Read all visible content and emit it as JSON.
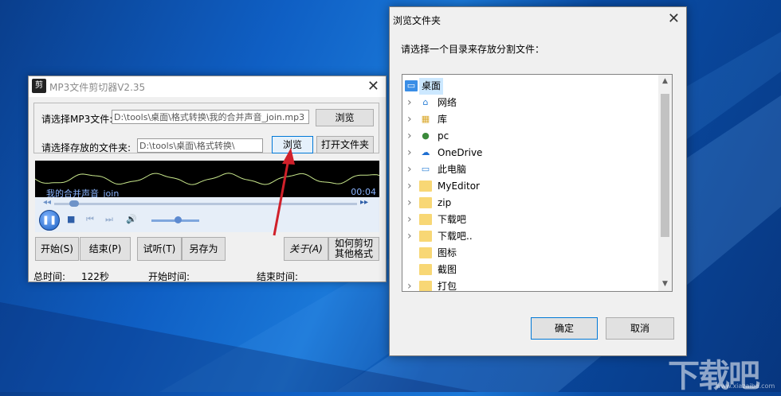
{
  "mp3_window": {
    "title": "MP3文件剪切器V2.35",
    "logo_text": "剪",
    "select_mp3_label": "请选择MP3文件:",
    "mp3_path": "D:\\tools\\桌面\\格式转换\\我的合并声音_join.mp3",
    "browse1_label": "浏览",
    "select_folder_label": "请选择存放的文件夹:",
    "folder_path": "D:\\tools\\桌面\\格式转换\\",
    "browse2_label": "浏览",
    "open_folder_label": "打开文件夹",
    "song_name": "我的合并声音_join",
    "time_display": "00:04",
    "progress": 0.05,
    "volume": 0.55,
    "start_btn": "开始(S)",
    "end_btn": "结束(P)",
    "preview_btn": "试听(T)",
    "save_as_btn": "另存为",
    "about_btn": "关于(A)",
    "how_cut_btn_line1": "如何剪切",
    "how_cut_btn_line2": "其他格式",
    "total_time_label": "总时间:",
    "total_time_value": "122秒",
    "start_time_label": "开始时间:",
    "end_time_label": "结束时间:"
  },
  "browse_dialog": {
    "title": "浏览文件夹",
    "prompt": "请选择一个目录来存放分割文件：",
    "tree": [
      {
        "label": "桌面",
        "icon": "desktop-icon",
        "selected": true,
        "root": true
      },
      {
        "label": "网络",
        "icon": "network-icon"
      },
      {
        "label": "库",
        "icon": "library-icon"
      },
      {
        "label": "pc",
        "icon": "user-icon"
      },
      {
        "label": "OneDrive",
        "icon": "cloud-icon"
      },
      {
        "label": "此电脑",
        "icon": "computer-icon"
      },
      {
        "label": "MyEditor",
        "icon": "folder-icon"
      },
      {
        "label": "zip",
        "icon": "folder-icon"
      },
      {
        "label": "下载吧",
        "icon": "folder-icon"
      },
      {
        "label": "下载吧..",
        "icon": "folder-icon"
      },
      {
        "label": "图标",
        "icon": "folder-icon",
        "no_arrow": true
      },
      {
        "label": "截图",
        "icon": "folder-icon",
        "no_arrow": true
      },
      {
        "label": "打包",
        "icon": "folder-icon"
      }
    ],
    "ok_label": "确定",
    "cancel_label": "取消"
  },
  "watermark": {
    "main": "下载吧",
    "sub": "www.xiazaiba.com"
  },
  "colors": {
    "accent": "#0078d7",
    "selection": "#cce8ff",
    "wave": "#c9e88c",
    "arrow": "#d0202a"
  }
}
